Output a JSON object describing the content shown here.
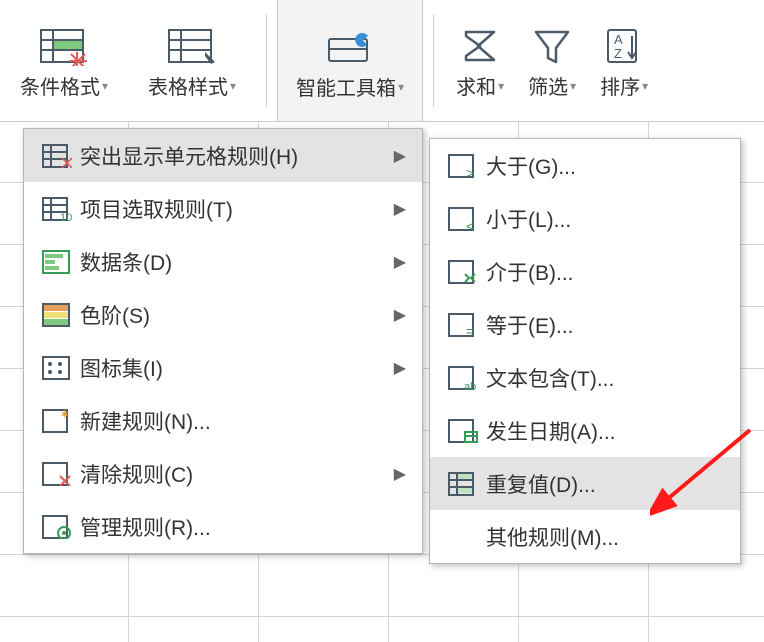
{
  "ribbon": {
    "cond_format": "条件格式",
    "table_style": "表格样式",
    "toolbox": "智能工具箱",
    "sum": "求和",
    "filter": "筛选",
    "sort": "排序"
  },
  "menu1": {
    "highlight": "突出显示单元格规则(H)",
    "top": "项目选取规则(T)",
    "databar": "数据条(D)",
    "colorscale": "色阶(S)",
    "iconset": "图标集(I)",
    "newrule": "新建规则(N)...",
    "clear": "清除规则(C)",
    "manage": "管理规则(R)..."
  },
  "menu2": {
    "gt": "大于(G)...",
    "lt": "小于(L)...",
    "between": "介于(B)...",
    "eq": "等于(E)...",
    "text": "文本包含(T)...",
    "date": "发生日期(A)...",
    "dup": "重复值(D)...",
    "more": "其他规则(M)..."
  }
}
